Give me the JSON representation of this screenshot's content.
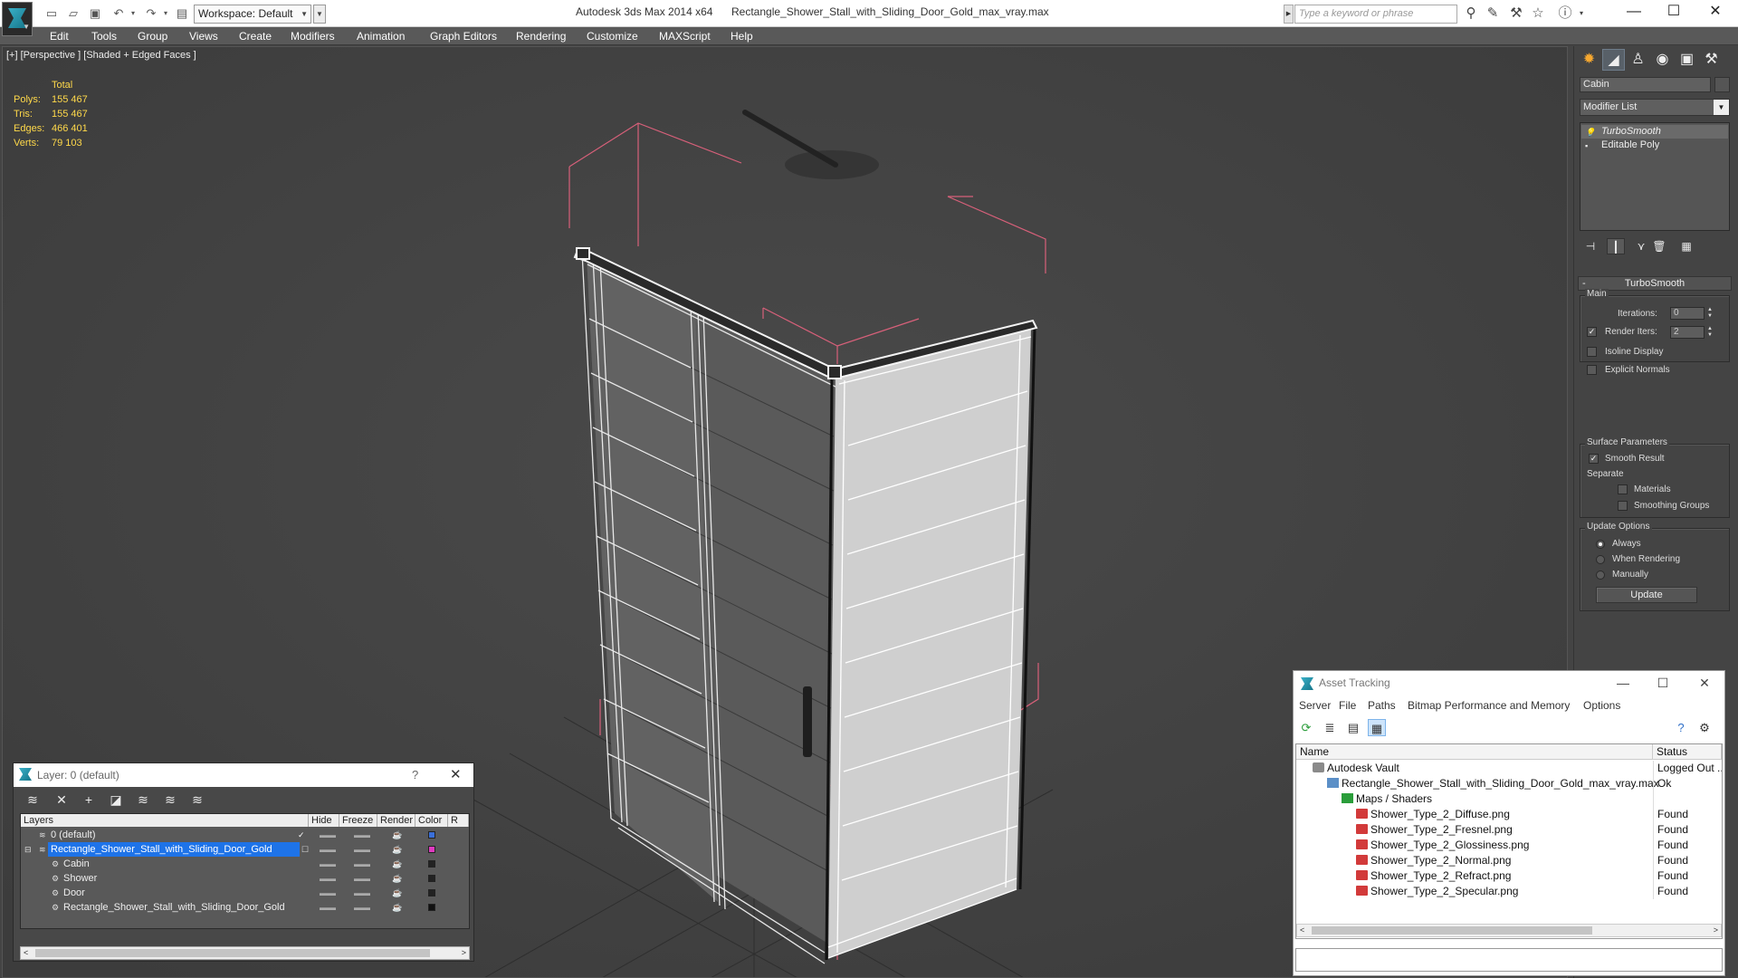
{
  "titlebar": {
    "app_title": "Autodesk 3ds Max  2014 x64",
    "file_title": "Rectangle_Shower_Stall_with_Sliding_Door_Gold_max_vray.max",
    "workspace": "Workspace: Default",
    "search_placeholder": "Type a keyword or phrase"
  },
  "menu": [
    "Edit",
    "Tools",
    "Group",
    "Views",
    "Create",
    "Modifiers",
    "Animation",
    "Graph Editors",
    "Rendering",
    "Customize",
    "MAXScript",
    "Help"
  ],
  "viewport": {
    "label": "[+] [Perspective ] [Shaded + Edged Faces ]",
    "stats": {
      "header": "Total",
      "rows": [
        {
          "label": "Polys:",
          "value": "155 467"
        },
        {
          "label": "Tris:",
          "value": "155 467"
        },
        {
          "label": "Edges:",
          "value": "466 401"
        },
        {
          "label": "Verts:",
          "value": "79 103"
        }
      ]
    }
  },
  "command_panel": {
    "object_name": "Cabin",
    "modifier_list": "Modifier List",
    "stack": [
      {
        "label": "TurboSmooth",
        "selected": true
      },
      {
        "label": "Editable Poly",
        "selected": false
      }
    ],
    "rollout_title": "TurboSmooth",
    "main_group": "Main",
    "iterations_label": "Iterations:",
    "iterations_value": "0",
    "render_iters_label": "Render Iters:",
    "render_iters_value": "2",
    "isoline_display": "Isoline Display",
    "explicit_normals": "Explicit Normals",
    "surface_group": "Surface Parameters",
    "smooth_result": "Smooth Result",
    "separate_label": "Separate",
    "materials": "Materials",
    "smoothing_groups": "Smoothing Groups",
    "update_group": "Update Options",
    "always": "Always",
    "when_rendering": "When Rendering",
    "manually": "Manually",
    "update_button": "Update"
  },
  "layer_panel": {
    "title": "Layer: 0 (default)",
    "help": "?",
    "columns": [
      "Layers",
      "Hide",
      "Freeze",
      "Render",
      "Color",
      "R"
    ],
    "rows": [
      {
        "name": "0 (default)",
        "indent": 1,
        "color": "#3a6fd8"
      },
      {
        "name": "Rectangle_Shower_Stall_with_Sliding_Door_Gold",
        "indent": 1,
        "color": "#e03ac0",
        "selected": true
      },
      {
        "name": "Cabin",
        "indent": 2,
        "color": "#222222"
      },
      {
        "name": "Shower",
        "indent": 2,
        "color": "#222222"
      },
      {
        "name": "Door",
        "indent": 2,
        "color": "#222222"
      },
      {
        "name": "Rectangle_Shower_Stall_with_Sliding_Door_Gold",
        "indent": 2,
        "color": "#111111"
      }
    ]
  },
  "asset_panel": {
    "title": "Asset Tracking",
    "menu": [
      "Server",
      "File",
      "Paths",
      "Bitmap Performance and Memory",
      "Options"
    ],
    "columns": [
      "Name",
      "Status"
    ],
    "rows": [
      {
        "name": "Autodesk Vault",
        "status": "Logged Out ...",
        "indent": 1,
        "icon": "vault"
      },
      {
        "name": "Rectangle_Shower_Stall_with_Sliding_Door_Gold_max_vray.max",
        "status": "Ok",
        "indent": 2,
        "icon": "file"
      },
      {
        "name": "Maps / Shaders",
        "status": "",
        "indent": 3,
        "icon": "maps"
      },
      {
        "name": "Shower_Type_2_Diffuse.png",
        "status": "Found",
        "indent": 4,
        "icon": "png"
      },
      {
        "name": "Shower_Type_2_Fresnel.png",
        "status": "Found",
        "indent": 4,
        "icon": "png"
      },
      {
        "name": "Shower_Type_2_Glossiness.png",
        "status": "Found",
        "indent": 4,
        "icon": "png"
      },
      {
        "name": "Shower_Type_2_Normal.png",
        "status": "Found",
        "indent": 4,
        "icon": "png"
      },
      {
        "name": "Shower_Type_2_Refract.png",
        "status": "Found",
        "indent": 4,
        "icon": "png"
      },
      {
        "name": "Shower_Type_2_Specular.png",
        "status": "Found",
        "indent": 4,
        "icon": "png"
      }
    ]
  },
  "colors": {
    "selection": "#1e73e8",
    "bbox": "#d8607a",
    "stats": "#ffd94a"
  }
}
